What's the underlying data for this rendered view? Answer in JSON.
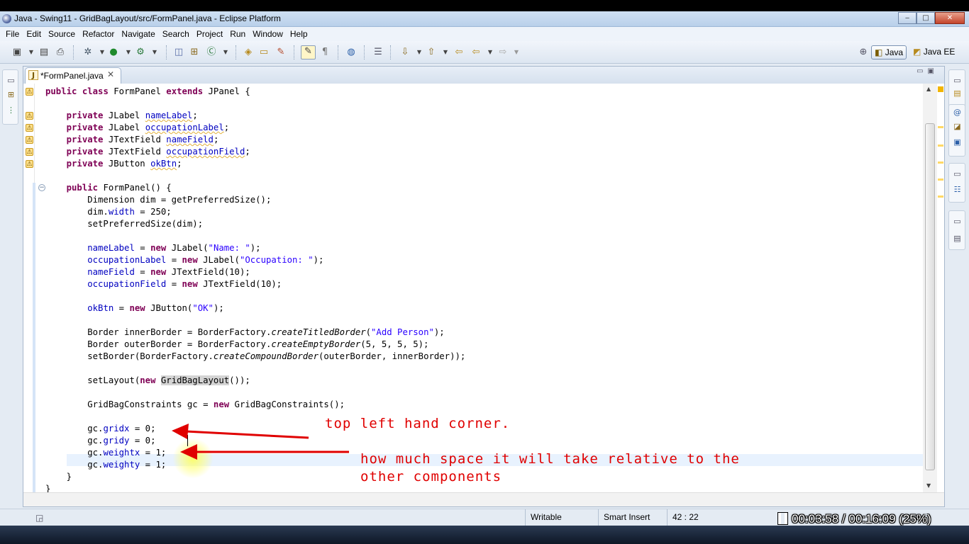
{
  "window": {
    "title": "Java - Swing11 - GridBagLayout/src/FormPanel.java - Eclipse Platform",
    "minimize": "‒",
    "maximize": "□",
    "close": "✕"
  },
  "menu": [
    "File",
    "Edit",
    "Source",
    "Refactor",
    "Navigate",
    "Search",
    "Project",
    "Run",
    "Window",
    "Help"
  ],
  "toolbar": {
    "icons": [
      "new-wizard-icon",
      "save-icon",
      "print-icon",
      "debug-icon",
      "run-icon",
      "external-tools-icon",
      "new-java-project-icon",
      "new-package-icon",
      "new-class-icon",
      "open-type-icon",
      "open-task-icon",
      "search-icon",
      "toggle-mark-occurrences-icon",
      "show-whitespace-icon",
      "web-browser-icon",
      "annotation-icon",
      "next-annotation-icon",
      "previous-annotation-icon",
      "last-edit-location-icon",
      "back-icon",
      "forward-icon"
    ],
    "perspectives": {
      "java": "Java",
      "java_ee": "Java EE"
    }
  },
  "editor": {
    "tab_label": "*FormPanel.java",
    "tab_icon_glyph": "J",
    "tab_close": "✕",
    "code_lines": [
      "public class FormPanel extends JPanel {",
      "",
      "    private JLabel nameLabel;",
      "    private JLabel occupationLabel;",
      "    private JTextField nameField;",
      "    private JTextField occupationField;",
      "    private JButton okBtn;",
      "",
      "    public FormPanel() {",
      "        Dimension dim = getPreferredSize();",
      "        dim.width = 250;",
      "        setPreferredSize(dim);",
      "",
      "        nameLabel = new JLabel(\"Name: \");",
      "        occupationLabel = new JLabel(\"Occupation: \");",
      "        nameField = new JTextField(10);",
      "        occupationField = new JTextField(10);",
      "",
      "        okBtn = new JButton(\"OK\");",
      "",
      "        Border innerBorder = BorderFactory.createTitledBorder(\"Add Person\");",
      "        Border outerBorder = BorderFactory.createEmptyBorder(5, 5, 5, 5);",
      "        setBorder(BorderFactory.createCompoundBorder(outerBorder, innerBorder));",
      "",
      "        setLayout(new GridBagLayout());",
      "",
      "        GridBagConstraints gc = new GridBagConstraints();",
      "",
      "        gc.gridx = 0;",
      "        gc.gridy = 0;",
      "        gc.weightx = 1;",
      "        gc.weighty = 1;",
      "    }",
      "}"
    ]
  },
  "annotations": {
    "top_left": "top left hand corner.",
    "weight_line1": "how much space it will take relative to the",
    "weight_line2": "other components",
    "color": "#e00000"
  },
  "status": {
    "writable": "Writable",
    "insert_mode": "Smart Insert",
    "position": "42 : 22"
  },
  "recorder": {
    "elapsed": "00:03:58",
    "separator": "/",
    "total": "00:16:09",
    "percent": "(25%)"
  }
}
